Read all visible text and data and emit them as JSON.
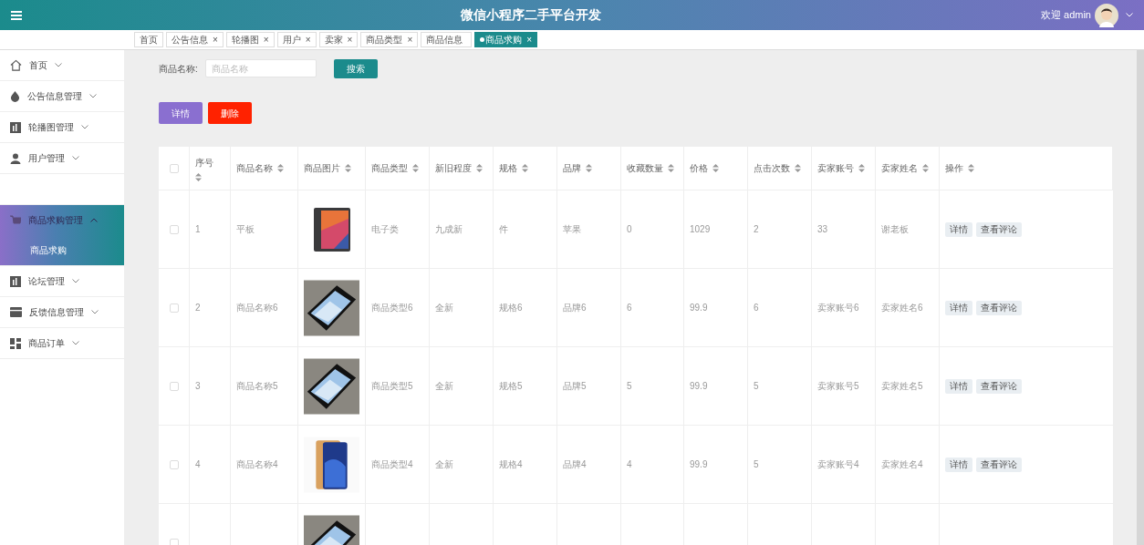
{
  "header": {
    "title": "微信小程序二手平台开发",
    "greeting": "欢迎 admin"
  },
  "tabs": [
    {
      "label": "首页",
      "selected": false
    },
    {
      "label": "公告信息",
      "close": "×",
      "selected": false
    },
    {
      "label": "轮播图",
      "close": "×",
      "selected": false
    },
    {
      "label": "用户",
      "close": "×",
      "selected": false
    },
    {
      "label": "卖家",
      "close": "×",
      "selected": false
    },
    {
      "label": "商品类型",
      "close": "×",
      "selected": false
    },
    {
      "label": "商品信息",
      "selected": false
    },
    {
      "label": "商品求购",
      "close": "×",
      "selected": true
    }
  ],
  "sidebar": {
    "items": [
      {
        "kind": "home",
        "label": "首页",
        "selected": false,
        "expanded": false
      },
      {
        "kind": "drop",
        "label": "公告信息管理",
        "selected": false,
        "expanded": false
      },
      {
        "kind": "chart",
        "label": "轮播图管理",
        "selected": false,
        "expanded": false
      },
      {
        "kind": "user",
        "label": "用户管理",
        "selected": false,
        "expanded": false
      },
      {
        "kind": "spacer"
      },
      {
        "kind": "cart",
        "label": "商品求购管理",
        "selected": true,
        "expanded": true,
        "children": [
          {
            "label": "商品求购",
            "selected": true
          }
        ]
      },
      {
        "kind": "chart",
        "label": "论坛管理",
        "selected": false,
        "expanded": false
      },
      {
        "kind": "wallet",
        "label": "反馈信息管理",
        "selected": false,
        "expanded": false
      },
      {
        "kind": "grid",
        "label": "商品订单",
        "selected": false,
        "expanded": false
      }
    ]
  },
  "search": {
    "label": "商品名称:",
    "placeholder": "商品名称",
    "button": "搜索"
  },
  "actions": [
    {
      "kind": "detail",
      "label": "详情"
    },
    {
      "kind": "delete",
      "label": "删除"
    }
  ],
  "table": {
    "header_checked": false,
    "columns": [
      "序号",
      "商品名称",
      "商品图片",
      "商品类型",
      "新旧程度",
      "规格",
      "品牌",
      "收藏数量",
      "价格",
      "点击次数",
      "卖家账号",
      "卖家姓名",
      "操作"
    ],
    "rows": [
      {
        "checked": false,
        "cells": [
          "1",
          "平板",
          "",
          "电子类",
          "九成新",
          "件",
          "苹果",
          "0",
          "1029",
          "2",
          "33",
          "谢老板"
        ],
        "image": {
          "kind": "tablet"
        },
        "buttons": [
          "详情",
          "查看评论"
        ]
      },
      {
        "checked": false,
        "cells": [
          "2",
          "商品名称6",
          "",
          "商品类型6",
          "全新",
          "规格6",
          "品牌6",
          "6",
          "99.9",
          "6",
          "卖家账号6",
          "卖家姓名6"
        ],
        "image": {
          "kind": "phone"
        },
        "buttons": [
          "详情",
          "查看评论"
        ]
      },
      {
        "checked": false,
        "cells": [
          "3",
          "商品名称5",
          "",
          "商品类型5",
          "全新",
          "规格5",
          "品牌5",
          "5",
          "99.9",
          "5",
          "卖家账号5",
          "卖家姓名5"
        ],
        "image": {
          "kind": "phone"
        },
        "buttons": [
          "详情",
          "查看评论"
        ]
      },
      {
        "checked": false,
        "cells": [
          "4",
          "商品名称4",
          "",
          "商品类型4",
          "全新",
          "规格4",
          "品牌4",
          "4",
          "99.9",
          "5",
          "卖家账号4",
          "卖家姓名4"
        ],
        "image": {
          "kind": "yellow_phone"
        },
        "buttons": [
          "详情",
          "查看评论"
        ]
      },
      {
        "checked": false,
        "cells": [
          "",
          "",
          "",
          "",
          "",
          "",
          "",
          "",
          "",
          "",
          "",
          ""
        ],
        "image": {
          "kind": "phone"
        }
      }
    ]
  }
}
